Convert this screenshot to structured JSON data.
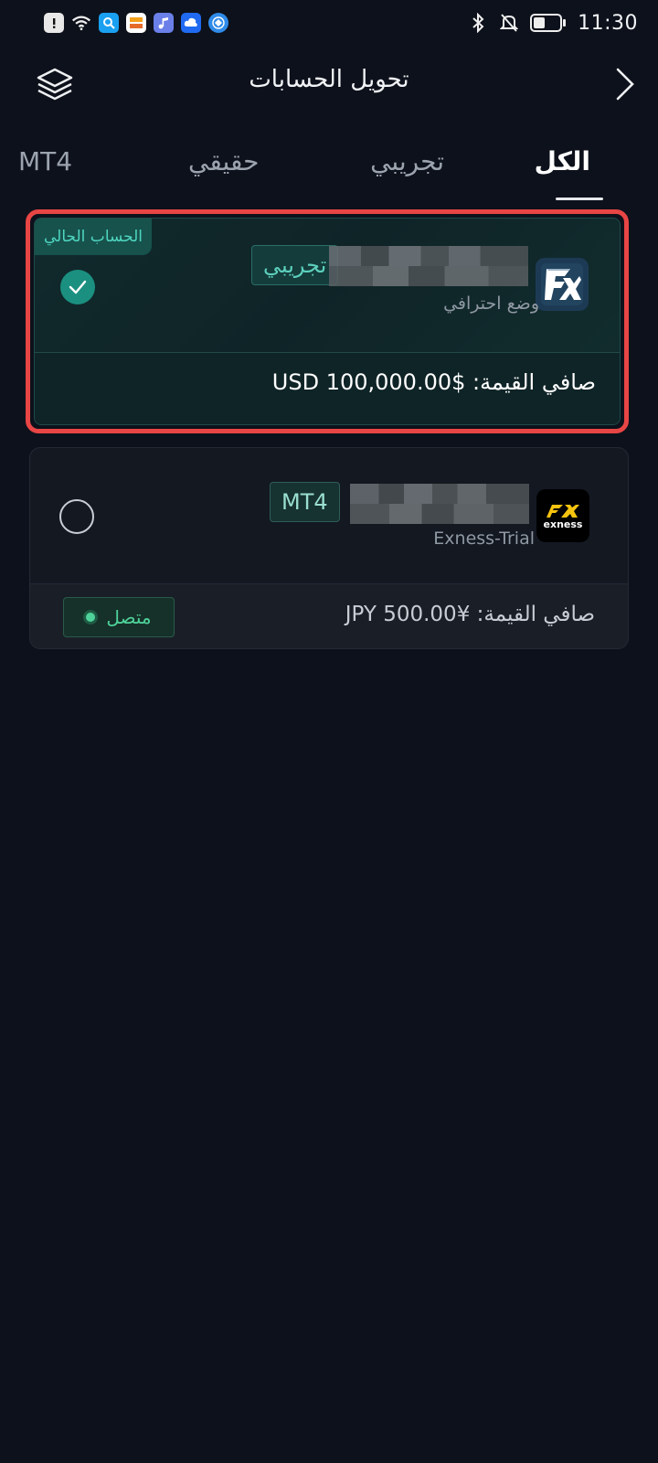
{
  "status_bar": {
    "time": "11:30",
    "left_icons": [
      "alert-icon",
      "wifi-icon",
      "search-app-icon",
      "gallery-app-icon",
      "music-app-icon",
      "cloud-app-icon",
      "browser-app-icon"
    ],
    "right_icons": [
      "bluetooth-icon",
      "mute-icon",
      "battery-icon"
    ]
  },
  "header": {
    "title": "تحويل الحسابات"
  },
  "tabs": [
    {
      "label": "الكل",
      "active": true
    },
    {
      "label": "تجريبي",
      "active": false
    },
    {
      "label": "حقيقي",
      "active": false
    },
    {
      "label": "MT4",
      "active": false
    }
  ],
  "accounts": [
    {
      "badge": "الحساب الحالي",
      "type_tag": "تجريبي",
      "subtitle": "وضع احترافي",
      "net_value": "صافي القيمة: $USD 100,000.00",
      "selected": true,
      "highlight_color": "#e84545"
    },
    {
      "type_tag": "MT4",
      "subtitle": "Exness-Trial",
      "logo_text": "exness",
      "net_value": "صافي القيمة: ¥JPY 500.00",
      "status": "متصل",
      "selected": false
    }
  ],
  "colors": {
    "background": "#0d111b",
    "accent": "#1b9080",
    "online": "#4fd29a"
  }
}
